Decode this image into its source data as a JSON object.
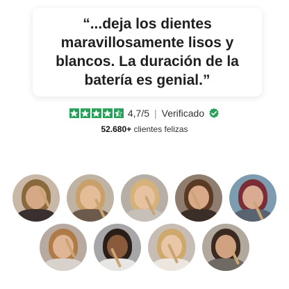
{
  "quote": {
    "text": "“...deja los dientes maravillosamente lisos y blancos. La duración de la batería es genial.”"
  },
  "rating": {
    "stars": 4.5,
    "star_icon": "star-icon",
    "value_text": "4,7/5",
    "separator": "|",
    "verified_text": "Verificado",
    "verified_icon": "verified-check-icon",
    "accent_color": "#27a15a"
  },
  "customers": {
    "count": "52.680+",
    "label": " clientes felizas"
  },
  "avatars": {
    "row1": [
      "customer-photo-1",
      "customer-photo-2",
      "customer-photo-3",
      "customer-photo-4",
      "customer-photo-5"
    ],
    "row2": [
      "customer-photo-6",
      "customer-photo-7",
      "customer-photo-8",
      "customer-photo-9"
    ]
  }
}
